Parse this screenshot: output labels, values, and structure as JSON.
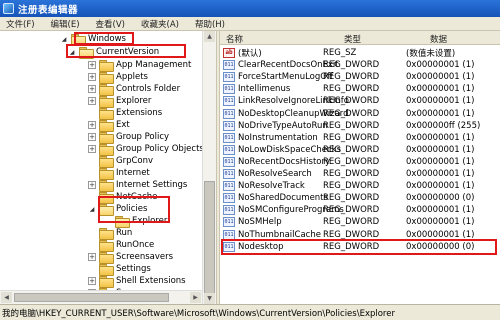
{
  "window": {
    "title": "注册表编辑器"
  },
  "menu": [
    "文件(F)",
    "编辑(E)",
    "查看(V)",
    "收藏夹(A)",
    "帮助(H)"
  ],
  "tree": {
    "items": [
      {
        "label": "Windows",
        "expander": "open",
        "folder": "open"
      },
      {
        "label": "CurrentVersion",
        "expander": "open",
        "folder": "open"
      },
      {
        "label": "App Management",
        "expander": "plus",
        "folder": "closed"
      },
      {
        "label": "Applets",
        "expander": "plus",
        "folder": "closed"
      },
      {
        "label": "Controls Folder",
        "expander": "plus",
        "folder": "closed"
      },
      {
        "label": "Explorer",
        "expander": "plus",
        "folder": "closed"
      },
      {
        "label": "Extensions",
        "expander": "none",
        "folder": "closed"
      },
      {
        "label": "Ext",
        "expander": "plus",
        "folder": "closed"
      },
      {
        "label": "Group Policy",
        "expander": "plus",
        "folder": "closed"
      },
      {
        "label": "Group Policy Objects",
        "expander": "plus",
        "folder": "closed"
      },
      {
        "label": "GrpConv",
        "expander": "none",
        "folder": "closed"
      },
      {
        "label": "Internet",
        "expander": "none",
        "folder": "closed"
      },
      {
        "label": "Internet Settings",
        "expander": "plus",
        "folder": "closed"
      },
      {
        "label": "NetCache",
        "expander": "none",
        "folder": "closed"
      },
      {
        "label": "Policies",
        "expander": "open",
        "folder": "open"
      },
      {
        "label": "Explorer",
        "expander": "none",
        "folder": "open",
        "selected": true
      },
      {
        "label": "Run",
        "expander": "none",
        "folder": "closed"
      },
      {
        "label": "RunOnce",
        "expander": "none",
        "folder": "closed"
      },
      {
        "label": "Screensavers",
        "expander": "plus",
        "folder": "closed"
      },
      {
        "label": "Settings",
        "expander": "none",
        "folder": "closed"
      },
      {
        "label": "Shell Extensions",
        "expander": "plus",
        "folder": "closed"
      },
      {
        "label": "Syncmgr",
        "expander": "plus",
        "folder": "closed"
      }
    ]
  },
  "list": {
    "columns": {
      "name": "名称",
      "type": "类型",
      "data": "数据"
    },
    "rows": [
      {
        "icon": "ab",
        "name": "(默认)",
        "type": "REG_SZ",
        "data": "(数值未设置)"
      },
      {
        "icon": "bin",
        "name": "ClearRecentDocsOnExit",
        "type": "REG_DWORD",
        "data": "0x00000001 (1)"
      },
      {
        "icon": "bin",
        "name": "ForceStartMenuLogOff",
        "type": "REG_DWORD",
        "data": "0x00000001 (1)"
      },
      {
        "icon": "bin",
        "name": "Intellimenus",
        "type": "REG_DWORD",
        "data": "0x00000001 (1)"
      },
      {
        "icon": "bin",
        "name": "LinkResolveIgnoreLinkInfo",
        "type": "REG_DWORD",
        "data": "0x00000001 (1)"
      },
      {
        "icon": "bin",
        "name": "NoDesktopCleanupWizard",
        "type": "REG_DWORD",
        "data": "0x00000001 (1)"
      },
      {
        "icon": "bin",
        "name": "NoDriveTypeAutoRun",
        "type": "REG_DWORD",
        "data": "0x000000ff (255)"
      },
      {
        "icon": "bin",
        "name": "NoInstrumentation",
        "type": "REG_DWORD",
        "data": "0x00000001 (1)"
      },
      {
        "icon": "bin",
        "name": "NoLowDiskSpaceChecks",
        "type": "REG_DWORD",
        "data": "0x00000001 (1)"
      },
      {
        "icon": "bin",
        "name": "NoRecentDocsHistory",
        "type": "REG_DWORD",
        "data": "0x00000001 (1)"
      },
      {
        "icon": "bin",
        "name": "NoResolveSearch",
        "type": "REG_DWORD",
        "data": "0x00000001 (1)"
      },
      {
        "icon": "bin",
        "name": "NoResolveTrack",
        "type": "REG_DWORD",
        "data": "0x00000001 (1)"
      },
      {
        "icon": "bin",
        "name": "NoSharedDocuments",
        "type": "REG_DWORD",
        "data": "0x00000000 (0)"
      },
      {
        "icon": "bin",
        "name": "NoSMConfigurePrograms",
        "type": "REG_DWORD",
        "data": "0x00000001 (1)"
      },
      {
        "icon": "bin",
        "name": "NoSMHelp",
        "type": "REG_DWORD",
        "data": "0x00000001 (1)"
      },
      {
        "icon": "bin",
        "name": "NoThumbnailCache",
        "type": "REG_DWORD",
        "data": "0x00000001 (1)"
      },
      {
        "icon": "bin",
        "name": "Nodesktop",
        "type": "REG_DWORD",
        "data": "0x00000000 (0)",
        "highlighted": true
      }
    ]
  },
  "statusbar": {
    "path": "我的电脑\\HKEY_CURRENT_USER\\Software\\Microsoft\\Windows\\CurrentVersion\\Policies\\Explorer"
  },
  "colors": {
    "titlebar": "#1f64cc",
    "highlight": "#e0181a",
    "chrome": "#ece9d8"
  }
}
